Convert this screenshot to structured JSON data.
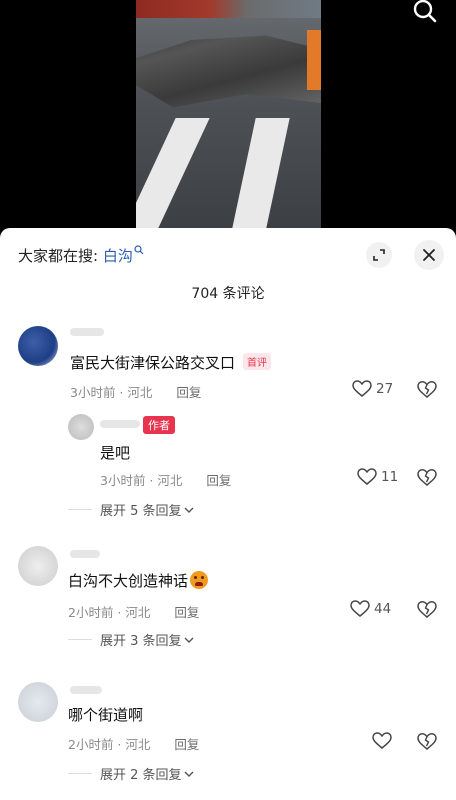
{
  "header": {
    "search_prefix": "大家都在搜: ",
    "search_keyword": "白沟",
    "comment_count": "704 条评论"
  },
  "comments": [
    {
      "text": "富民大街津保公路交叉口",
      "badge": "首评",
      "time": "3小时前 · 河北",
      "reply_label": "回复",
      "likes": "27",
      "replies": [
        {
          "badge": "作者",
          "text": "是吧",
          "time": "3小时前 · 河北",
          "reply_label": "回复",
          "likes": "11"
        }
      ],
      "expand_label": "展开 5 条回复"
    },
    {
      "text": "白沟不大创造神话",
      "time": "2小时前 · 河北",
      "reply_label": "回复",
      "likes": "44",
      "expand_label": "展开 3 条回复"
    },
    {
      "text": "哪个街道啊",
      "time": "2小时前 · 河北",
      "reply_label": "回复",
      "likes": "",
      "expand_label": "展开 2 条回复"
    }
  ],
  "icons": {
    "search": "search-icon",
    "expand": "expand-icon",
    "close": "close-icon",
    "like": "heart-icon",
    "dislike": "broken-heart-icon",
    "chevron": "chevron-down-icon"
  },
  "colors": {
    "accent_link": "#2a5db0",
    "badge_red": "#e8344e"
  }
}
